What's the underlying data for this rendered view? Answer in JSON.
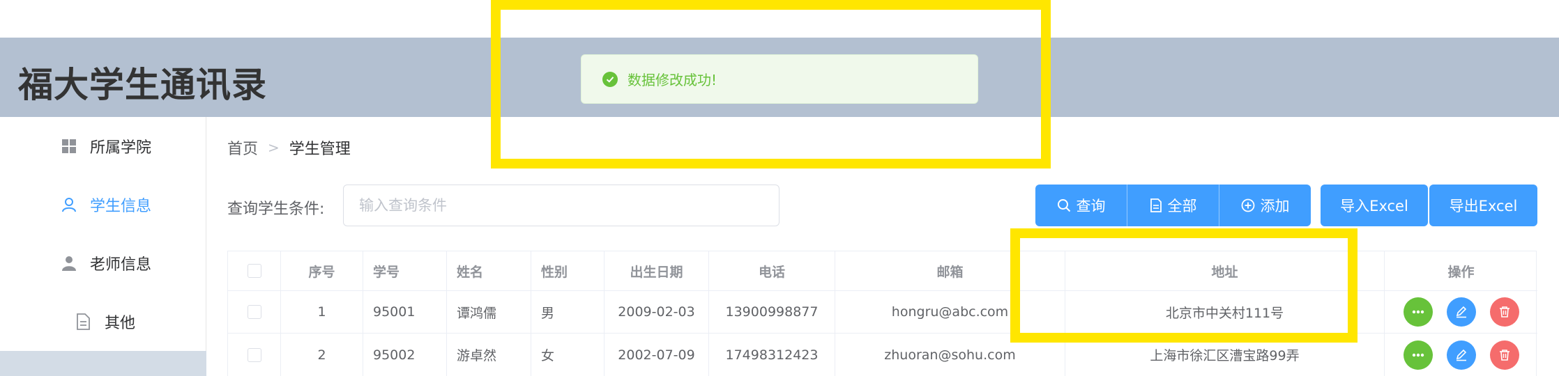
{
  "header": {
    "title": "福大学生通讯录"
  },
  "sidebar": {
    "items": [
      {
        "label": "所属学院",
        "icon": "grid-icon",
        "active": false
      },
      {
        "label": "学生信息",
        "icon": "user-outline-icon",
        "active": true
      },
      {
        "label": "老师信息",
        "icon": "user-filled-icon",
        "active": false
      },
      {
        "label": "其他",
        "icon": "document-icon",
        "active": false
      }
    ]
  },
  "breadcrumb": {
    "home": "首页",
    "separator": ">",
    "current": "学生管理"
  },
  "query": {
    "label": "查询学生条件:",
    "placeholder": "输入查询条件"
  },
  "buttons": {
    "search": "查询",
    "all": "全部",
    "add": "添加",
    "import": "导入Excel",
    "export": "导出Excel"
  },
  "table": {
    "columns": [
      "",
      "序号",
      "学号",
      "姓名",
      "性别",
      "出生日期",
      "电话",
      "邮箱",
      "地址",
      "操作"
    ],
    "rows": [
      [
        "1",
        "95001",
        "谭鸿儒",
        "男",
        "2009-02-03",
        "13900998877",
        "hongru@abc.com",
        "北京市中关村111号"
      ],
      [
        "2",
        "95002",
        "游卓然",
        "女",
        "2002-07-09",
        "17498312423",
        "zhuoran@sohu.com",
        "上海市徐汇区漕宝路99弄"
      ]
    ]
  },
  "toast": {
    "message": "数据修改成功!",
    "type": "success"
  },
  "colors": {
    "primary": "#409eff",
    "success": "#67c23a",
    "danger": "#f56c6c",
    "header_bg": "#b3c0d1",
    "highlight": "#ffe600"
  }
}
